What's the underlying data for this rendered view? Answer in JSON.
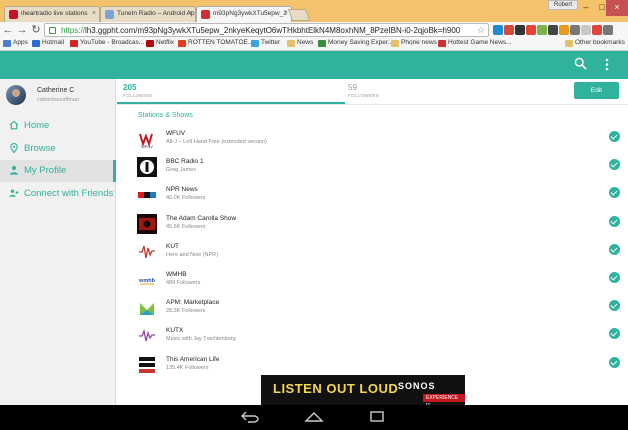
{
  "browser": {
    "tabs": [
      {
        "title": "iheartradio live stations",
        "fav_color": "#c8102e",
        "active": false
      },
      {
        "title": "TuneIn Radio – Android Ap",
        "fav_color": "#7aa4d8",
        "active": false
      },
      {
        "title": "m93pNg3ywkXTu5epw_2",
        "fav_color": "#d12f2f",
        "active": true
      }
    ],
    "user_name": "Robert",
    "url_scheme": "https://",
    "url_rest": "lh3.ggpht.com/m93pNg3ywkXTu5epw_2nkyeKeqytO6wTHkbhtElkN4M8oxhNM_8PzeIBN-i0-2qjoBk=h900",
    "bookmarks": [
      {
        "label": "Apps",
        "color": "#4a7fd0"
      },
      {
        "label": "Hotmail",
        "color": "#2a6bd1"
      },
      {
        "label": "YouTube - Broadcas...",
        "color": "#d62222"
      },
      {
        "label": "Netflix",
        "color": "#b20710"
      },
      {
        "label": "ROTTEN TOMATOE...",
        "color": "#e23b1e"
      },
      {
        "label": "Twitter",
        "color": "#3aa3e3"
      },
      {
        "label": "News",
        "color": "#e5c26a"
      },
      {
        "label": "Money Saving Exper...",
        "color": "#3a8d3a"
      },
      {
        "label": "Phone news",
        "color": "#e5c26a"
      },
      {
        "label": "Hottest Game News...",
        "color": "#d13030"
      }
    ],
    "other_bookmarks": "Other bookmarks",
    "extension_colors": [
      "#1d8ad4",
      "#d64a3c",
      "#333333",
      "#e34234",
      "#7bb24a",
      "#444444",
      "#e69a1f",
      "#777777",
      "#c8c8c8",
      "#e0443a",
      "#777777"
    ]
  },
  "profile": {
    "name": "Catherine C",
    "email": "catherinecoffman"
  },
  "nav": [
    {
      "label": "Home",
      "icon": "home-icon"
    },
    {
      "label": "Browse",
      "icon": "location-icon"
    },
    {
      "label": "My Profile",
      "icon": "person-icon",
      "active": true
    },
    {
      "label": "Connect with Friends",
      "icon": "friends-icon"
    }
  ],
  "stats": {
    "following_count": "205",
    "following_label": "FOLLOWING",
    "followers_count": "59",
    "followers_label": "FOLLOWERS"
  },
  "edit_label": "Edit",
  "section_title": "Stations & Shows",
  "stations": [
    {
      "name": "WFUV",
      "sub": "Alt-J – Left Hand Free (extended version)",
      "logo": "wfuv-logo"
    },
    {
      "name": "BBC Radio 1",
      "sub": "Greg James",
      "logo": "bbc-radio1-logo"
    },
    {
      "name": "NPR News",
      "sub": "40.0K Followers",
      "logo": "npr-logo"
    },
    {
      "name": "The Adam Carolla Show",
      "sub": "45.6K Followers",
      "logo": "adam-carolla-logo"
    },
    {
      "name": "KUT",
      "sub": "Here and Now (NPR)",
      "logo": "kut-logo"
    },
    {
      "name": "WMHB",
      "sub": "489 Followers",
      "logo": "wmhb-logo"
    },
    {
      "name": "APM: Marketplace",
      "sub": "28.3K Followers",
      "logo": "marketplace-logo"
    },
    {
      "name": "KUTX",
      "sub": "Music with Jay Trachtenberg",
      "logo": "kutx-logo"
    },
    {
      "name": "This American Life",
      "sub": "135.4K Followers",
      "logo": "tal-logo"
    }
  ],
  "ad": {
    "headline": "LISTEN OUT LOUD",
    "brand": "SONOS",
    "cta": "EXPERIENCE IT"
  },
  "colors": {
    "accent": "#30b29c"
  }
}
